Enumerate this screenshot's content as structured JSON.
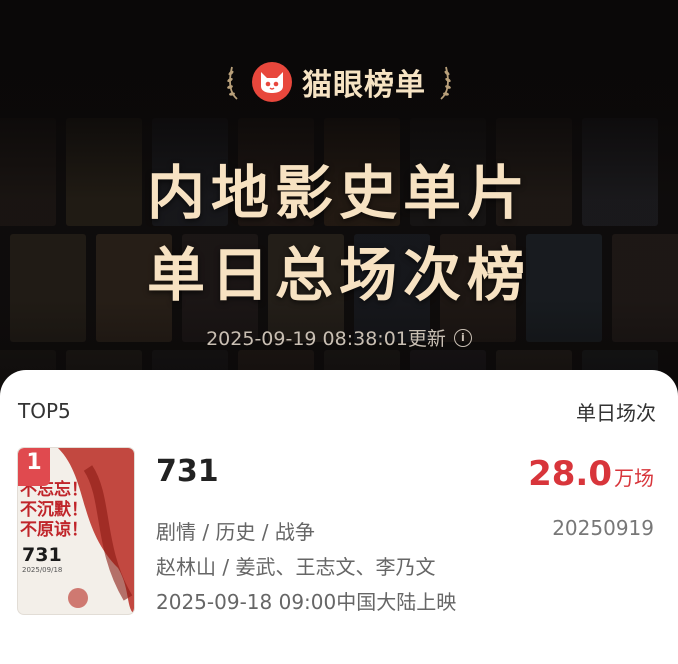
{
  "header": {
    "brand": "猫眼榜单",
    "title_line1": "内地影史单片",
    "title_line2": "单日总场次榜",
    "updated_time": "2025-09-19 08:38:01更新",
    "info_icon": "info-icon",
    "logo_icon": "maoyan-cat-logo",
    "laurel_icon": "laurel-icon"
  },
  "list": {
    "section_label": "TOP5",
    "column_label": "单日场次",
    "items": [
      {
        "rank": "1",
        "title": "731",
        "genres": "剧情 / 历史 / 战争",
        "cast": "赵林山 / 姜武、王志文、李乃文",
        "release": "2025-09-18 09:00中国大陆上映",
        "value": "28.0",
        "unit": "万场",
        "date_code": "20250919",
        "poster_slogan": "不忘忘！不沉默！不原谅！",
        "poster_title": "731",
        "poster_date": "2025/09/18"
      }
    ]
  },
  "colors": {
    "accent_red": "#d8353b",
    "title_cream": "#f7e2c2",
    "badge_red": "#e04a4f",
    "header_bg": "#141110"
  }
}
